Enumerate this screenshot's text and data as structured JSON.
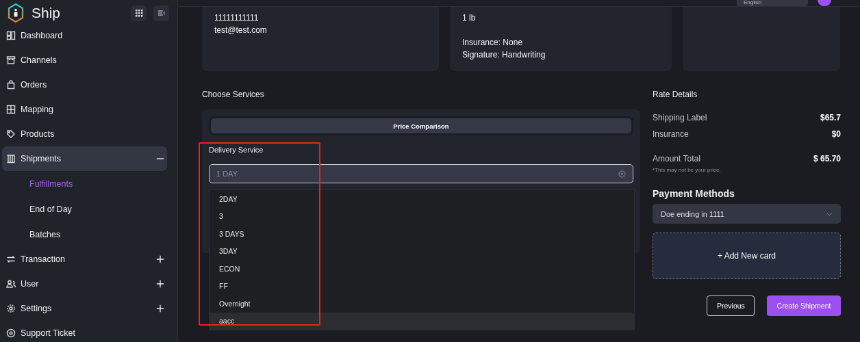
{
  "sidebar": {
    "brand": "Ship",
    "items": [
      {
        "label": "Dashboard",
        "selected": false
      },
      {
        "label": "Channels",
        "selected": false
      },
      {
        "label": "Orders",
        "selected": false
      },
      {
        "label": "Mapping",
        "selected": false
      },
      {
        "label": "Products",
        "selected": false
      },
      {
        "label": "Shipments",
        "expanded": true,
        "selected": true,
        "children": [
          {
            "label": "Fulfillments",
            "selected": true
          },
          {
            "label": "End of Day",
            "selected": false
          },
          {
            "label": "Batches",
            "selected": false
          }
        ]
      },
      {
        "label": "Transaction",
        "expanded": false,
        "selected": false
      },
      {
        "label": "User",
        "expanded": false,
        "selected": false
      },
      {
        "label": "Settings",
        "expanded": false,
        "selected": false
      },
      {
        "label": "Support Ticket",
        "selected": false
      }
    ]
  },
  "header": {
    "language": "English"
  },
  "cards": [
    {
      "groups": [
        [
          "11111111111",
          "test@test.com"
        ]
      ]
    },
    {
      "groups": [
        [
          "1 lb"
        ],
        [
          "Insurance: None",
          "Signature: Handwriting"
        ]
      ]
    }
  ],
  "services": {
    "title": "Choose Services",
    "tab": "Price Comparison",
    "field_label": "Delivery Service",
    "placeholder": "1 DAY",
    "options": [
      {
        "label": "2DAY",
        "selected": false
      },
      {
        "label": "3",
        "selected": false
      },
      {
        "label": "3 DAYS",
        "selected": false
      },
      {
        "label": "3DAY",
        "selected": false
      },
      {
        "label": "ECON",
        "selected": false
      },
      {
        "label": "FF",
        "selected": false
      },
      {
        "label": "Overnight",
        "selected": false
      },
      {
        "label": "aacc",
        "selected": true
      }
    ]
  },
  "rate": {
    "title": "Rate Details",
    "rows": [
      {
        "label": "Shipping Label",
        "value": "$65.7"
      },
      {
        "label": "Insurance",
        "value": "$0"
      }
    ],
    "total_label": "Amount Total",
    "total": "$ 65.70",
    "note": "*This may not be your price."
  },
  "payment": {
    "title": "Payment Methods",
    "selected_card": "Doe ending in 1111",
    "add": "+ Add New card"
  },
  "buttons": [
    {
      "label": "Previous",
      "kind": "outline"
    },
    {
      "label": "Create Shipment",
      "kind": "primary"
    }
  ]
}
